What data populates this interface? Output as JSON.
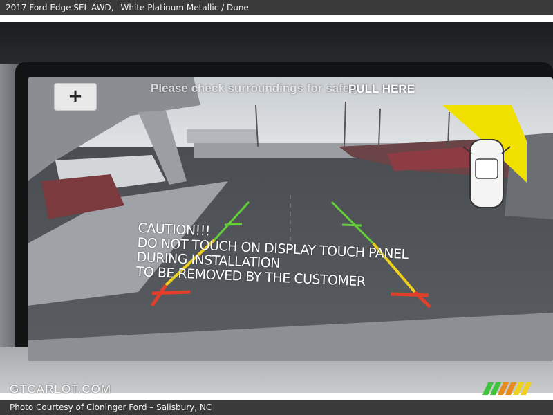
{
  "header": {
    "vehicle": "2017 Ford Edge SEL AWD,",
    "color": "White Platinum Metallic / Dune"
  },
  "camera": {
    "zoom_button_label": "+",
    "zoom_icon": "plus-icon",
    "warning_banner": "Please check surroundings for safety",
    "pull_label": "PULL HERE",
    "guide_colors": {
      "near": "#e0402a",
      "mid": "#f0d21e",
      "far": "#63d038"
    },
    "tab_color": "#f0e000",
    "caution_lines": [
      "CAUTION!!!",
      "DO NOT TOUCH ON DISPLAY TOUCH PANEL",
      "DURING INSTALLATION",
      "TO BE REMOVED BY THE CUSTOMER"
    ]
  },
  "footer": {
    "watermark": "GTCARLOT.COM",
    "credit": "Photo Courtesy of Cloninger Ford – Salisbury, NC",
    "stripe_colors": [
      "#3cc43c",
      "#3cc43c",
      "#e88a1e",
      "#e88a1e",
      "#f0d21e",
      "#f0d21e"
    ]
  }
}
